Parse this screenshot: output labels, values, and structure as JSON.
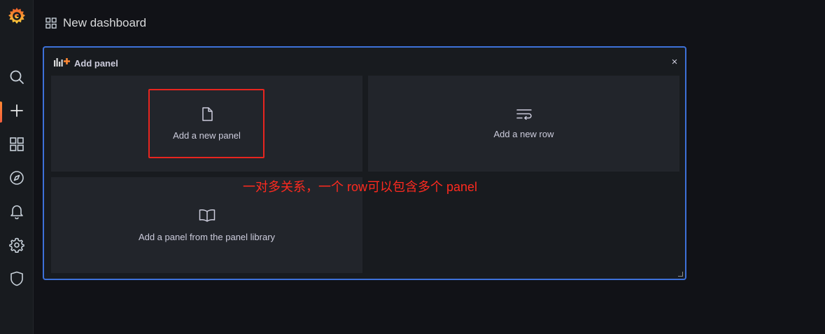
{
  "header": {
    "title": "New dashboard"
  },
  "sidebar": {
    "items": [
      {
        "icon": "grafana-logo-icon"
      },
      {
        "icon": "search-icon"
      },
      {
        "icon": "plus-icon",
        "active": true
      },
      {
        "icon": "dashboards-grid-icon"
      },
      {
        "icon": "explore-compass-icon"
      },
      {
        "icon": "alerting-bell-icon"
      },
      {
        "icon": "configuration-gear-icon"
      },
      {
        "icon": "server-admin-shield-icon"
      }
    ]
  },
  "add_panel": {
    "title": "Add panel",
    "close_label": "×",
    "options": {
      "new_panel": "Add a new panel",
      "new_row": "Add a new row",
      "library": "Add a panel from the panel library"
    }
  },
  "annotation": {
    "text": "一对多关系，一个 row可以包含多个 panel",
    "color": "#ff2a1f"
  },
  "colors": {
    "accent_border": "#3d71d9",
    "highlight_border": "#e8251f",
    "active_indicator": "#ff8833",
    "background": "#111217",
    "panel_bg": "#22252b"
  }
}
